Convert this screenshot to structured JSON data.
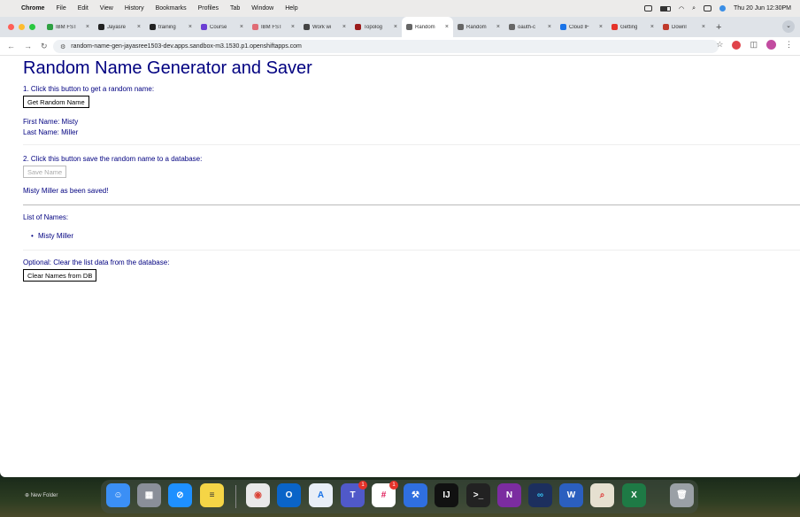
{
  "menubar": {
    "app": "Chrome",
    "menus": [
      "File",
      "Edit",
      "View",
      "History",
      "Bookmarks",
      "Profiles",
      "Tab",
      "Window",
      "Help"
    ],
    "clock": "Thu 20 Jun  12:30PM"
  },
  "tabs": [
    {
      "title": "IBM FST",
      "color": "#2ea043"
    },
    {
      "title": "Jayasre",
      "color": "#222222"
    },
    {
      "title": "training",
      "color": "#222222"
    },
    {
      "title": "Course",
      "color": "#6b3fd4"
    },
    {
      "title": "IBM FST",
      "color": "#e06c75"
    },
    {
      "title": "Work wi",
      "color": "#444444"
    },
    {
      "title": "Topolog",
      "color": "#9b1c1c"
    },
    {
      "title": "Random",
      "color": "#666666"
    },
    {
      "title": "Random",
      "color": "#666666"
    },
    {
      "title": "oauth-c",
      "color": "#666666"
    },
    {
      "title": "Cloud IF",
      "color": "#1a73e8"
    },
    {
      "title": "Getting",
      "color": "#e5332a"
    },
    {
      "title": "Downl",
      "color": "#c0392b"
    }
  ],
  "active_tab_index": 7,
  "newtab_label": "+",
  "address": "random-name-gen-jayasree1503-dev.apps.sandbox-m3.1530.p1.openshiftapps.com",
  "page": {
    "title": "Random Name Generator and Saver",
    "step1": "1. Click this button to get a random name:",
    "get_button": "Get Random Name",
    "first_name": "First Name: Misty",
    "last_name": "Last Name: Miller",
    "step2": "2. Click this button save the random name to a database:",
    "save_button": "Save Name",
    "saved_msg": "Misty Miller as been saved!",
    "list_heading": "List of Names:",
    "names": [
      "Misty Miller"
    ],
    "optional": "Optional: Clear the list data from the database:",
    "clear_button": "Clear Names from DB"
  },
  "desktop": {
    "new_folder": "New Folder"
  },
  "dock": {
    "teams_badge": "1",
    "slack_badge": "1",
    "teams_new": "NEW"
  }
}
